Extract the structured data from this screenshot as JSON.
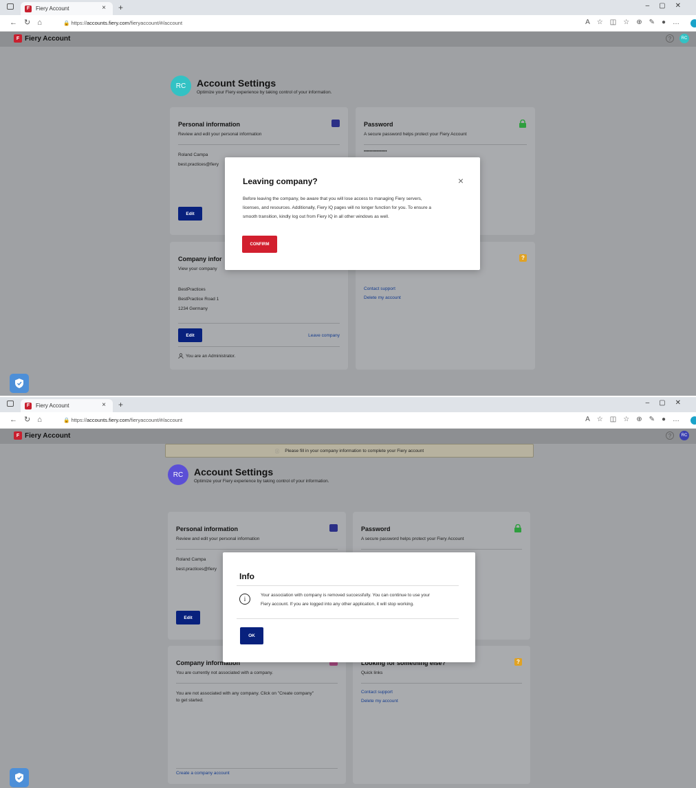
{
  "browser": {
    "tab_title": "Fiery Account",
    "url_prefix": "https://",
    "url_host": "accounts.fiery.com",
    "url_path": "/fieryaccount/#/account",
    "new_tab": "+",
    "tab_close": "×"
  },
  "app": {
    "brand": "Fiery Account",
    "brand_initial": "F",
    "help": "?",
    "user_initials": "RC"
  },
  "screen1": {
    "settings": {
      "title": "Account Settings",
      "subtitle": "Optimize your Fiery experience by taking control of your information.",
      "avatar_initials": "RC"
    },
    "personal": {
      "title": "Personal information",
      "subtitle": "Review and edit your personal information",
      "name": "Roland Campa",
      "email": "best.practices@fiery",
      "edit": "Edit"
    },
    "password": {
      "title": "Password",
      "subtitle": "A secure password helps protect your Fiery Account",
      "masked": "••••••••••••••••"
    },
    "company": {
      "title": "Company infor",
      "subtitle": "View your company",
      "line1": "BestPractices",
      "line2": "BestPractice Road 1",
      "line3": "1234 Germany",
      "edit": "Edit",
      "leave": "Leave company",
      "role": "You are an Administrator."
    },
    "other": {
      "contact": "Contact support",
      "delete": "Delete my account"
    },
    "modal": {
      "title": "Leaving company?",
      "close": "×",
      "body_line1": "Before leaving the company, be aware that you will lose access to managing Fiery servers,",
      "body_line2": "licenses, and resources. Additionally, Fiery IQ pages will no longer function for you. To ensure a",
      "body_line3": "smooth transition, kindly log out from Fiery IQ in all other windows as well.",
      "confirm": "CONFIRM"
    }
  },
  "screen2": {
    "banner": "Please fill in your company information to complete your Fiery account",
    "settings": {
      "title": "Account Settings",
      "subtitle": "Optimize your Fiery experience by taking control of your information.",
      "avatar_initials": "RC"
    },
    "personal": {
      "title": "Personal information",
      "subtitle": "Review and edit your personal information",
      "name": "Roland Campa",
      "email": "best.practices@fiery",
      "edit": "Edit"
    },
    "password": {
      "title": "Password",
      "subtitle": "A secure password helps protect your Fiery Account"
    },
    "company": {
      "title": "Company information",
      "subtitle": "You are currently not associated with a company.",
      "note_line1": "You are not associated with any company. Click on \"Create company\"",
      "note_line2": "to get started.",
      "create": "Create a company account"
    },
    "other": {
      "title": "Looking for something else?",
      "subtitle": "Quick links",
      "contact": "Contact support",
      "delete": "Delete my account"
    },
    "modal": {
      "title": "Info",
      "body_line1": "Your association with company is removed successfully. You can continue to use your",
      "body_line2": "Fiery account. If you are logged into any other application, it will stop working.",
      "ok": "OK",
      "info_glyph": "i"
    }
  },
  "colors": {
    "accent_blue": "#08217d",
    "confirm_red": "#d21f2e",
    "avatar_teal": "#33c2c4",
    "avatar_purple": "#5b4fd6",
    "lock_green": "#2e9e3e",
    "question_orange": "#e0a224",
    "idcard_navy": "#2b2f86"
  }
}
